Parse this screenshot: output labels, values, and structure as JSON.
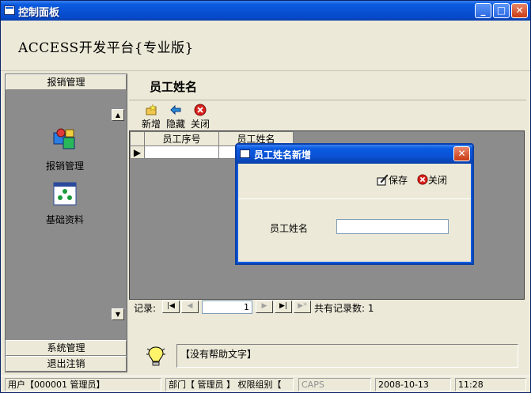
{
  "window": {
    "title": "控制面板"
  },
  "app": {
    "title": "ACCESS开发平台{专业版}"
  },
  "leftnav": {
    "top_section": "报销管理",
    "items": [
      {
        "label": "报销管理",
        "icon": "reimbursement-icon"
      },
      {
        "label": "基础资料",
        "icon": "basic-data-icon"
      }
    ],
    "bottom_sections": [
      "系统管理",
      "退出注销"
    ]
  },
  "form": {
    "title": "员工姓名",
    "toolbar": {
      "add": "新增",
      "hide": "隐藏",
      "close": "关闭"
    },
    "grid": {
      "columns": [
        "员工序号",
        "员工姓名"
      ]
    },
    "record_nav": {
      "label": "记录:",
      "current": "1",
      "total_label": "共有记录数: 1"
    }
  },
  "help": {
    "text": "【没有帮助文字】"
  },
  "status": {
    "user": "用户【000001 管理员】",
    "dept": "部门【 管理员 】 权限组别【",
    "caps": "CAPS",
    "date": "2008-10-13",
    "time": "11:28"
  },
  "dialog": {
    "title": "员工姓名新增",
    "save": "保存",
    "close": "关闭",
    "field_label": "员工姓名",
    "field_value": ""
  },
  "colors": {
    "titlebar": "#0a5be0",
    "close": "#c93a13",
    "grid_bg": "#8c8c8c"
  }
}
